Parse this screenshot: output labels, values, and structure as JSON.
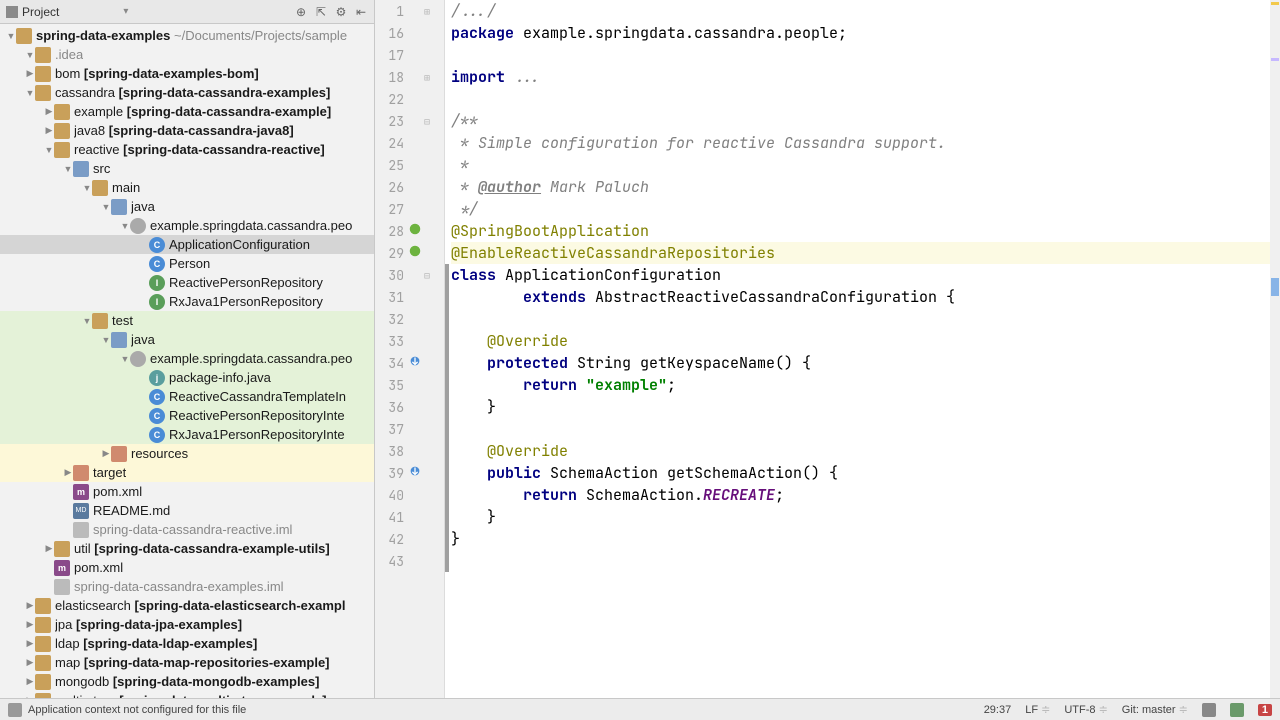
{
  "project": {
    "title": "Project",
    "rootName": "spring-data-examples",
    "rootPath": "~/Documents/Projects/sample",
    "tree": [
      {
        "d": 1,
        "arrow": "open",
        "ico": "folder",
        "label": ".idea",
        "muted": true
      },
      {
        "d": 1,
        "arrow": "closed",
        "ico": "folder",
        "label": "bom",
        "extra": "[spring-data-examples-bom]"
      },
      {
        "d": 1,
        "arrow": "open",
        "ico": "folder",
        "label": "cassandra",
        "extra": "[spring-data-cassandra-examples]"
      },
      {
        "d": 2,
        "arrow": "closed",
        "ico": "folder",
        "label": "example",
        "extra": "[spring-data-cassandra-example]"
      },
      {
        "d": 2,
        "arrow": "closed",
        "ico": "folder",
        "label": "java8",
        "extra": "[spring-data-cassandra-java8]"
      },
      {
        "d": 2,
        "arrow": "open",
        "ico": "folder",
        "label": "reactive",
        "extra": "[spring-data-cassandra-reactive]"
      },
      {
        "d": 3,
        "arrow": "open",
        "ico": "folder-blue",
        "label": "src"
      },
      {
        "d": 4,
        "arrow": "open",
        "ico": "folder",
        "label": "main"
      },
      {
        "d": 5,
        "arrow": "open",
        "ico": "folder-blue",
        "label": "java"
      },
      {
        "d": 6,
        "arrow": "open",
        "ico": "pkg",
        "label": "example.springdata.cassandra.peo"
      },
      {
        "d": 7,
        "arrow": "none",
        "ico": "class-c",
        "icoText": "C",
        "label": "ApplicationConfiguration",
        "sel": true
      },
      {
        "d": 7,
        "arrow": "none",
        "ico": "class-c",
        "icoText": "C",
        "label": "Person"
      },
      {
        "d": 7,
        "arrow": "none",
        "ico": "class-i",
        "icoText": "I",
        "label": "ReactivePersonRepository"
      },
      {
        "d": 7,
        "arrow": "none",
        "ico": "class-i",
        "icoText": "I",
        "label": "RxJava1PersonRepository"
      },
      {
        "d": 4,
        "arrow": "open",
        "ico": "folder",
        "label": "test",
        "hl": "green"
      },
      {
        "d": 5,
        "arrow": "open",
        "ico": "folder-blue",
        "label": "java",
        "hl": "green"
      },
      {
        "d": 6,
        "arrow": "open",
        "ico": "pkg",
        "label": "example.springdata.cassandra.peo",
        "hl": "green"
      },
      {
        "d": 7,
        "arrow": "none",
        "ico": "class-j",
        "icoText": "j",
        "label": "package-info.java",
        "hl": "green"
      },
      {
        "d": 7,
        "arrow": "none",
        "ico": "class-c",
        "icoText": "C",
        "label": "ReactiveCassandraTemplateIn",
        "hl": "green"
      },
      {
        "d": 7,
        "arrow": "none",
        "ico": "class-c",
        "icoText": "C",
        "label": "ReactivePersonRepositoryInte",
        "hl": "green"
      },
      {
        "d": 7,
        "arrow": "none",
        "ico": "class-c",
        "icoText": "C",
        "label": "RxJava1PersonRepositoryInte",
        "hl": "green"
      },
      {
        "d": 5,
        "arrow": "closed",
        "ico": "folder-red",
        "label": "resources",
        "hl": "yellow"
      },
      {
        "d": 3,
        "arrow": "closed",
        "ico": "folder-red",
        "label": "target",
        "hl": "yellow"
      },
      {
        "d": 3,
        "arrow": "none",
        "ico": "mvn",
        "icoText": "m",
        "label": "pom.xml"
      },
      {
        "d": 3,
        "arrow": "none",
        "ico": "md",
        "icoText": "MD",
        "label": "README.md"
      },
      {
        "d": 3,
        "arrow": "none",
        "ico": "iml",
        "label": "spring-data-cassandra-reactive.iml",
        "muted": true
      },
      {
        "d": 2,
        "arrow": "closed",
        "ico": "folder",
        "label": "util",
        "extra": "[spring-data-cassandra-example-utils]"
      },
      {
        "d": 2,
        "arrow": "none",
        "ico": "mvn",
        "icoText": "m",
        "label": "pom.xml"
      },
      {
        "d": 2,
        "arrow": "none",
        "ico": "iml",
        "label": "spring-data-cassandra-examples.iml",
        "muted": true
      },
      {
        "d": 1,
        "arrow": "closed",
        "ico": "folder",
        "label": "elasticsearch",
        "extra": "[spring-data-elasticsearch-exampl"
      },
      {
        "d": 1,
        "arrow": "closed",
        "ico": "folder",
        "label": "jpa",
        "extra": "[spring-data-jpa-examples]"
      },
      {
        "d": 1,
        "arrow": "closed",
        "ico": "folder",
        "label": "ldap",
        "extra": "[spring-data-ldap-examples]"
      },
      {
        "d": 1,
        "arrow": "closed",
        "ico": "folder",
        "label": "map",
        "extra": "[spring-data-map-repositories-example]"
      },
      {
        "d": 1,
        "arrow": "closed",
        "ico": "folder",
        "label": "mongodb",
        "extra": "[spring-data-mongodb-examples]"
      },
      {
        "d": 1,
        "arrow": "closed",
        "ico": "folder",
        "label": "multi-store",
        "extra": "[spring-data-multi-store-example]"
      }
    ]
  },
  "editor": {
    "gutterNums": [
      "1",
      "16",
      "17",
      "18",
      "22",
      "23",
      "24",
      "25",
      "26",
      "27",
      "28",
      "29",
      "30",
      "31",
      "32",
      "33",
      "34",
      "35",
      "36",
      "37",
      "38",
      "39",
      "40",
      "41",
      "42",
      "43"
    ],
    "caretLineIndex": 11,
    "stripStart": 12,
    "lines": [
      {
        "tokens": [
          {
            "t": "/.../",
            "c": "comment"
          }
        ]
      },
      {
        "tokens": [
          {
            "t": "package ",
            "c": "kw"
          },
          {
            "t": "example.springdata.cassandra.people;",
            "c": "ident"
          }
        ]
      },
      {
        "tokens": [
          {
            "t": "",
            "c": ""
          }
        ]
      },
      {
        "tokens": [
          {
            "t": "import ",
            "c": "kw"
          },
          {
            "t": "...",
            "c": "comment"
          }
        ]
      },
      {
        "tokens": [
          {
            "t": "",
            "c": ""
          }
        ]
      },
      {
        "tokens": [
          {
            "t": "/**",
            "c": "comment"
          }
        ]
      },
      {
        "tokens": [
          {
            "t": " * Simple configuration for reactive Cassandra support.",
            "c": "comment"
          }
        ]
      },
      {
        "tokens": [
          {
            "t": " *",
            "c": "comment"
          }
        ]
      },
      {
        "tokens": [
          {
            "t": " * ",
            "c": "comment"
          },
          {
            "t": "@author",
            "c": "doctag"
          },
          {
            "t": " Mark Paluch",
            "c": "comment"
          }
        ]
      },
      {
        "tokens": [
          {
            "t": " */",
            "c": "comment"
          }
        ]
      },
      {
        "tokens": [
          {
            "t": "@",
            "c": "anno"
          },
          {
            "t": "SpringBootApplication",
            "c": "anno"
          }
        ],
        "mark": "spring"
      },
      {
        "tokens": [
          {
            "t": "@EnableReactiveCassandraRepositories",
            "c": "anno"
          }
        ],
        "mark": "spring",
        "hl": true
      },
      {
        "tokens": [
          {
            "t": "class ",
            "c": "kw"
          },
          {
            "t": "ApplicationConfiguration",
            "c": "cls"
          }
        ]
      },
      {
        "tokens": [
          {
            "t": "        ",
            "c": ""
          },
          {
            "t": "extends ",
            "c": "kw"
          },
          {
            "t": "AbstractReactiveCassandraConfiguration {",
            "c": "ident"
          }
        ]
      },
      {
        "tokens": [
          {
            "t": "",
            "c": ""
          }
        ]
      },
      {
        "tokens": [
          {
            "t": "    ",
            "c": ""
          },
          {
            "t": "@Override",
            "c": "anno"
          }
        ]
      },
      {
        "tokens": [
          {
            "t": "    ",
            "c": ""
          },
          {
            "t": "protected ",
            "c": "kw"
          },
          {
            "t": "String getKeyspaceName() {",
            "c": "ident"
          }
        ],
        "mark": "override"
      },
      {
        "tokens": [
          {
            "t": "        ",
            "c": ""
          },
          {
            "t": "return ",
            "c": "kw"
          },
          {
            "t": "\"example\"",
            "c": "str"
          },
          {
            "t": ";",
            "c": "ident"
          }
        ]
      },
      {
        "tokens": [
          {
            "t": "    }",
            "c": "ident"
          }
        ]
      },
      {
        "tokens": [
          {
            "t": "",
            "c": ""
          }
        ]
      },
      {
        "tokens": [
          {
            "t": "    ",
            "c": ""
          },
          {
            "t": "@Override",
            "c": "anno"
          }
        ]
      },
      {
        "tokens": [
          {
            "t": "    ",
            "c": ""
          },
          {
            "t": "public ",
            "c": "kw"
          },
          {
            "t": "SchemaAction getSchemaAction() {",
            "c": "ident"
          }
        ],
        "mark": "override"
      },
      {
        "tokens": [
          {
            "t": "        ",
            "c": ""
          },
          {
            "t": "return ",
            "c": "kw"
          },
          {
            "t": "SchemaAction.",
            "c": "ident"
          },
          {
            "t": "RECREATE",
            "c": "field"
          },
          {
            "t": ";",
            "c": "ident"
          }
        ]
      },
      {
        "tokens": [
          {
            "t": "    }",
            "c": "ident"
          }
        ]
      },
      {
        "tokens": [
          {
            "t": "}",
            "c": "ident"
          }
        ]
      },
      {
        "tokens": [
          {
            "t": "",
            "c": ""
          }
        ]
      }
    ]
  },
  "status": {
    "message": "Application context not configured for this file",
    "pos": "29:37",
    "lineSep": "LF",
    "encoding": "UTF-8",
    "git": "Git: master",
    "notifCount": "1"
  }
}
